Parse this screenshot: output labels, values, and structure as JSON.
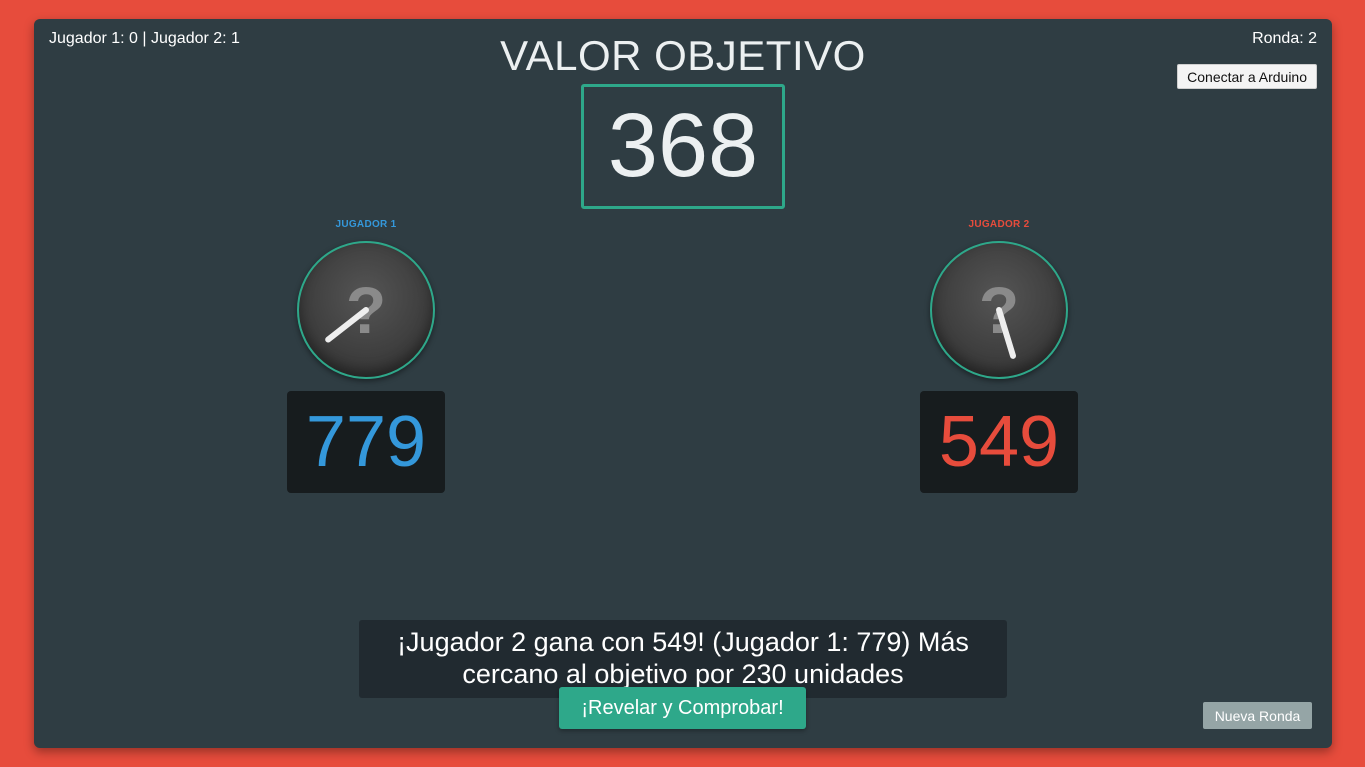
{
  "scoreboard": {
    "score_text": "Jugador 1: 0 | Jugador 2: 1",
    "round_text": "Ronda: 2"
  },
  "connect_button_label": "Conectar a Arduino",
  "target": {
    "title": "VALOR OBJETIVO",
    "value": "368"
  },
  "players": [
    {
      "label": "JUGADOR 1",
      "dial_symbol": "?",
      "needle_angle_deg": 232,
      "value": "779",
      "color": "#3498db"
    },
    {
      "label": "JUGADOR 2",
      "dial_symbol": "?",
      "needle_angle_deg": 163,
      "value": "549",
      "color": "#e74c3c"
    }
  ],
  "result_message": "¡Jugador 2 gana con 549! (Jugador 1: 779) Más cercano al objetivo por 230 unidades",
  "reveal_button_label": "¡Revelar y Comprobar!",
  "new_round_button_label": "Nueva Ronda",
  "colors": {
    "background": "#e74c3c",
    "panel": "#2f3d43",
    "accent": "#2ea88a",
    "player1": "#3498db",
    "player2": "#e74c3c"
  }
}
